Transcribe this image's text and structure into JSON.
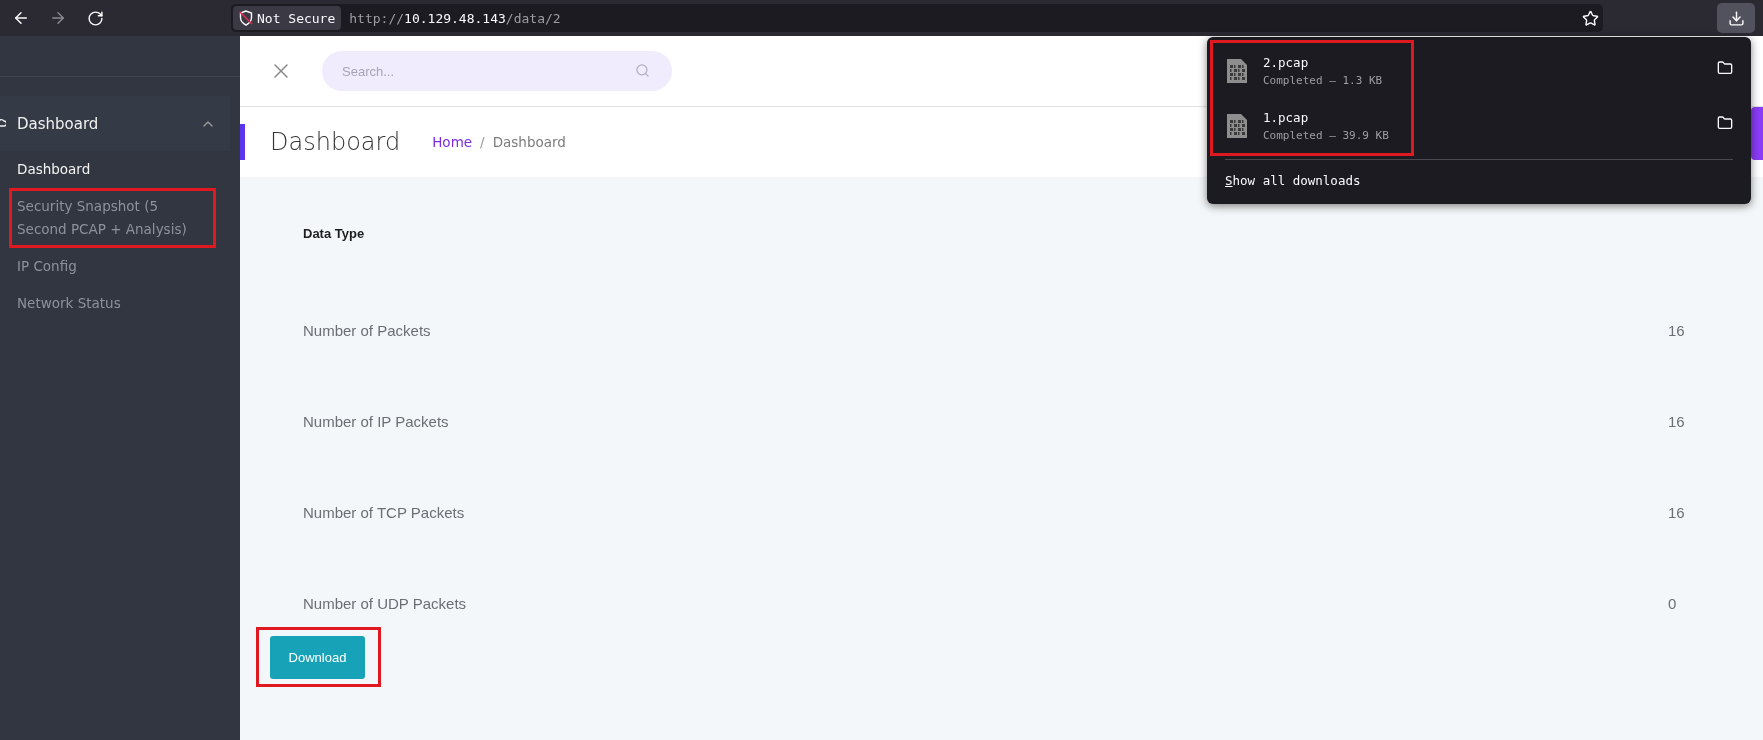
{
  "browser": {
    "back": {
      "disabled": false
    },
    "forward": {
      "disabled": true
    },
    "security": "Not Secure",
    "url": {
      "scheme": "http://",
      "host": "10.129.48.143",
      "path": "/data/2"
    },
    "downloads_button": {
      "active": true
    }
  },
  "downloads_panel": {
    "highlighted": true,
    "items": [
      {
        "name": "2.pcap",
        "status": "Completed — 1.3 KB"
      },
      {
        "name": "1.pcap",
        "status": "Completed — 39.9 KB"
      }
    ],
    "show_all": "Show all downloads"
  },
  "sidebar": {
    "section": {
      "label": "Dashboard",
      "expanded": true,
      "children": [
        {
          "label": "Dashboard",
          "selected": true,
          "highlighted": false
        },
        {
          "label": "Security Snapshot (5 Second PCAP + Analysis)",
          "selected": false,
          "highlighted": true
        },
        {
          "label": "IP Config",
          "selected": false,
          "highlighted": false
        },
        {
          "label": "Network Status",
          "selected": false,
          "highlighted": false
        }
      ]
    }
  },
  "header": {
    "search": {
      "placeholder": "Search..."
    }
  },
  "page": {
    "title": "Dashboard",
    "breadcrumb": [
      {
        "label": "Home",
        "kind": "link"
      },
      {
        "label": "Dashboard",
        "kind": "current"
      }
    ],
    "separator": "/"
  },
  "table": {
    "column_1": "Data Type",
    "rows": [
      {
        "label": "Number of Packets",
        "value": "16"
      },
      {
        "label": "Number of IP Packets",
        "value": "16"
      },
      {
        "label": "Number of TCP Packets",
        "value": "16"
      },
      {
        "label": "Number of UDP Packets",
        "value": "0"
      }
    ]
  },
  "download_button": {
    "label": "Download",
    "highlighted": true
  }
}
